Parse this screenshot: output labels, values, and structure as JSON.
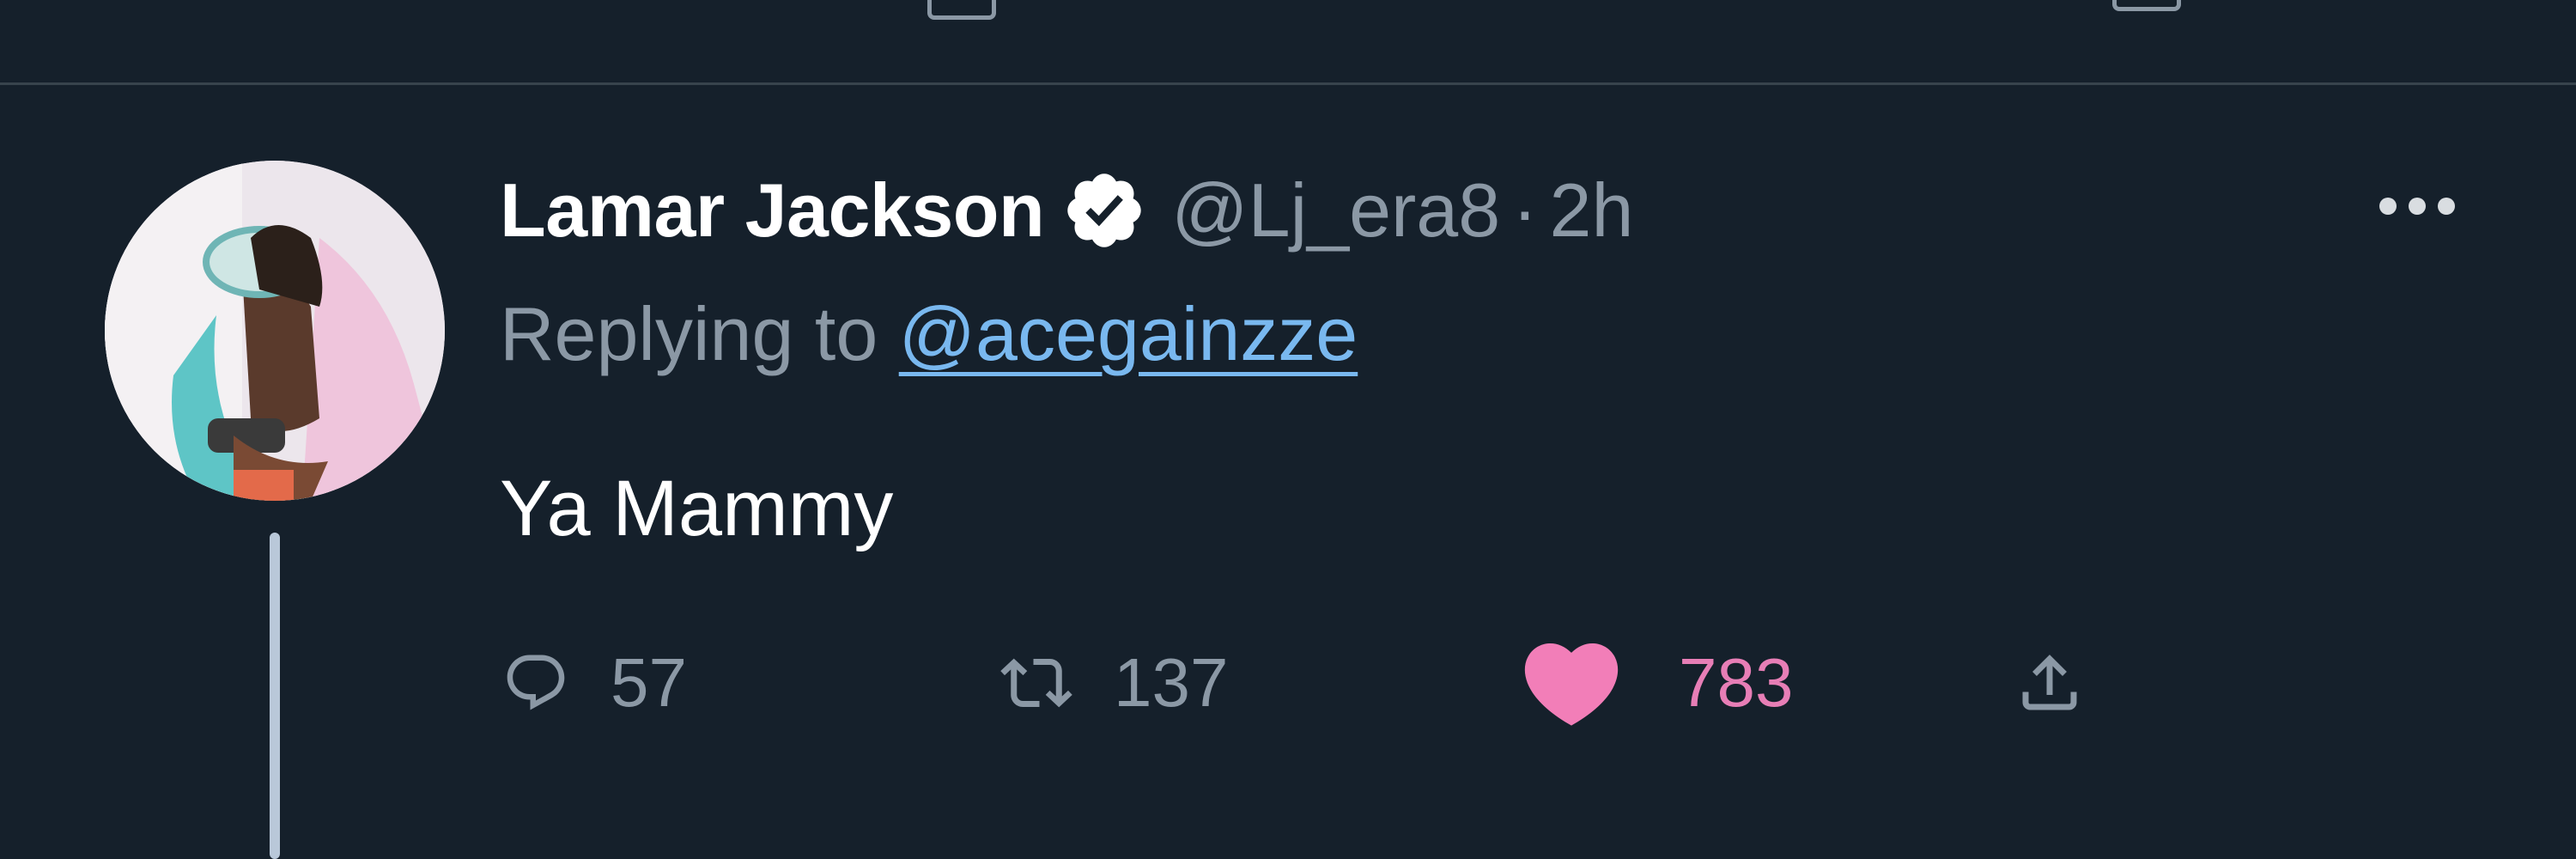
{
  "tweet": {
    "display_name": "Lamar Jackson",
    "handle": "@Lj_era8",
    "separator": "·",
    "time": "2h",
    "replying_prefix": "Replying to ",
    "replying_to": "@acegainzze",
    "text": "Ya Mammy",
    "verified": true
  },
  "actions": {
    "replies": "57",
    "retweets": "137",
    "likes": "783",
    "liked": true
  },
  "icons": {
    "reply": "speech-bubble-icon",
    "retweet": "retweet-arrows-icon",
    "like": "heart-icon",
    "share": "share-upload-icon",
    "more": "ellipsis-icon",
    "verified": "verified-badge-icon"
  },
  "colors": {
    "background": "#15202b",
    "secondary_text": "#8b98a5",
    "link": "#79b8ef",
    "like": "#f27eb8",
    "divider": "#38444d"
  }
}
